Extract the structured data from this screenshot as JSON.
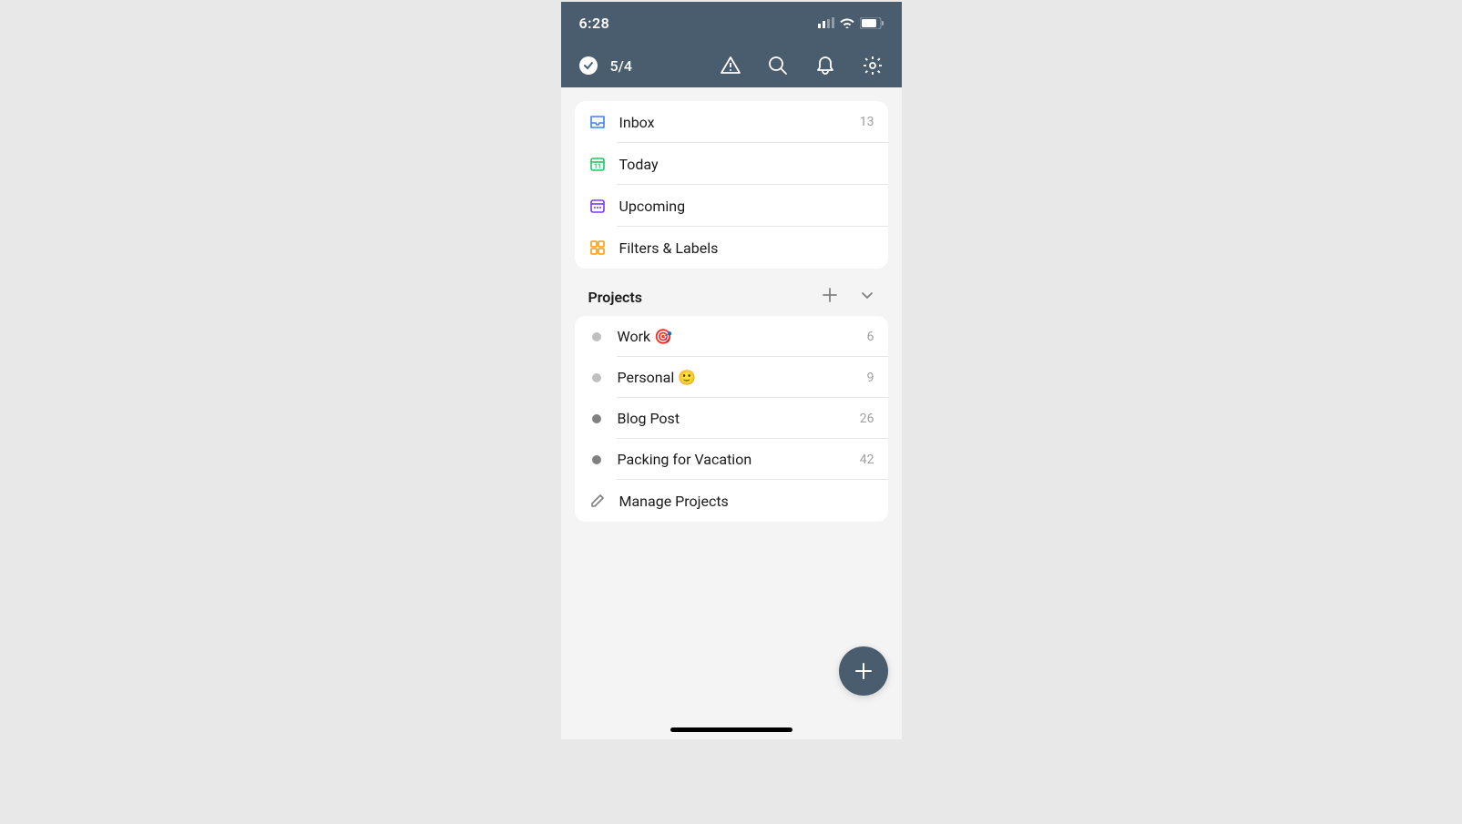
{
  "statusBar": {
    "time": "6:28"
  },
  "toolbar": {
    "progress": "5/4"
  },
  "views": [
    {
      "label": "Inbox",
      "count": "13",
      "icon": "inbox",
      "color": "#3b82f6"
    },
    {
      "label": "Today",
      "count": "",
      "icon": "today",
      "color": "#22c55e"
    },
    {
      "label": "Upcoming",
      "count": "",
      "icon": "upcoming",
      "color": "#7c3aed"
    },
    {
      "label": "Filters & Labels",
      "count": "",
      "icon": "filters",
      "color": "#f59e0b"
    }
  ],
  "projectsSection": {
    "title": "Projects"
  },
  "projects": [
    {
      "label": "Work 🎯",
      "count": "6",
      "dotColor": "#c0c0c0"
    },
    {
      "label": "Personal 🙂",
      "count": "9",
      "dotColor": "#c0c0c0"
    },
    {
      "label": "Blog Post",
      "count": "26",
      "dotColor": "#808080"
    },
    {
      "label": "Packing for Vacation",
      "count": "42",
      "dotColor": "#808080"
    }
  ],
  "manageProjects": {
    "label": "Manage Projects"
  }
}
